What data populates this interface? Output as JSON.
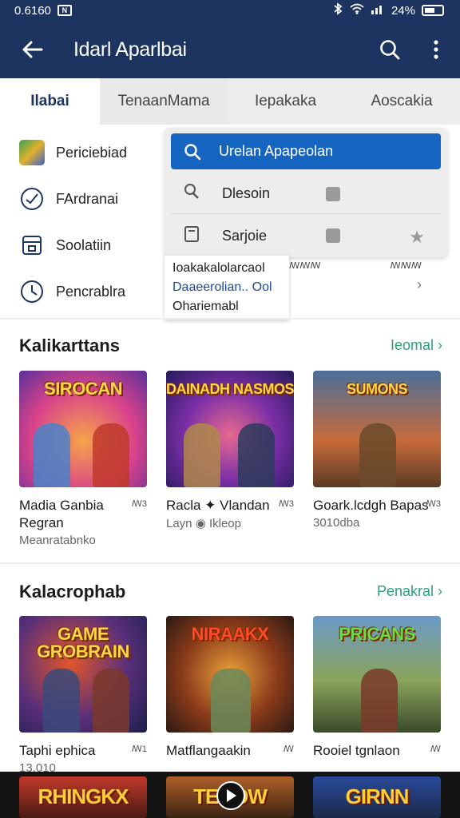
{
  "status_bar": {
    "time": "0.6160",
    "box_label": "N",
    "battery_text": "24%"
  },
  "app_bar": {
    "title": "Idarl Aparlbai"
  },
  "tabs": [
    {
      "label": "Ilabai",
      "active": true
    },
    {
      "label": "TenaanMama",
      "active": false
    },
    {
      "label": "Iepakaka",
      "active": false
    },
    {
      "label": "Aoscakia",
      "active": false
    }
  ],
  "menu": {
    "items": [
      {
        "label": "Periciebiad",
        "icon": "app-icon"
      },
      {
        "label": "FArdranai",
        "icon": "check-circle-icon"
      },
      {
        "label": "Soolatiin",
        "icon": "store-icon"
      },
      {
        "label": "Pencrablra",
        "icon": "clock-icon"
      }
    ]
  },
  "dropdown": {
    "search_text": "Urelan Apapeolan",
    "rows": [
      {
        "label": "Dlesoin",
        "icon": "search-person-icon"
      },
      {
        "label": "Sarjoie",
        "icon": "tablet-icon"
      }
    ]
  },
  "suggestion": {
    "line1": "Ioakakalolarcaol",
    "line2": "Daaeerolian.. Ool",
    "line3": "Ohariemabl",
    "side1": "ꟿꟿꟿ",
    "side2": "ꟿꟿꟿ"
  },
  "sections": [
    {
      "title": "Kalikarttans",
      "link": "Ieomal ›",
      "cards": [
        {
          "thumb_title": "SIROCAN",
          "name": "Madia Ganbia Regran",
          "sub": "Meanratabnko",
          "rating": "ꟿ3"
        },
        {
          "thumb_title": "DAINADH NASMOS",
          "name": "Racla ✦ Vlandan",
          "sub": "Layn ◉ Ikleop",
          "rating": "ꟿ3"
        },
        {
          "thumb_title": "SUMONS",
          "name": "Goark.lcdgh Bapas",
          "sub": "3010dba",
          "rating": "ꟿ3"
        }
      ]
    },
    {
      "title": "Kalacrophab",
      "link": "Penakral ›",
      "cards": [
        {
          "thumb_title": "GAME GROBRAIN",
          "name": "Taphi ephica",
          "sub": "13.010",
          "rating": "ꟿ1"
        },
        {
          "thumb_title": "NIRAAKX",
          "name": "Matflangaakin",
          "sub": "",
          "rating": "ꟿ"
        },
        {
          "thumb_title": "PRICANS",
          "name": "Rooiel tgnlaon",
          "sub": "",
          "rating": "ꟿ"
        }
      ]
    }
  ],
  "bottom_strip": {
    "cards": [
      "RHINGKX",
      "TEBOW",
      "GIRNN"
    ]
  }
}
